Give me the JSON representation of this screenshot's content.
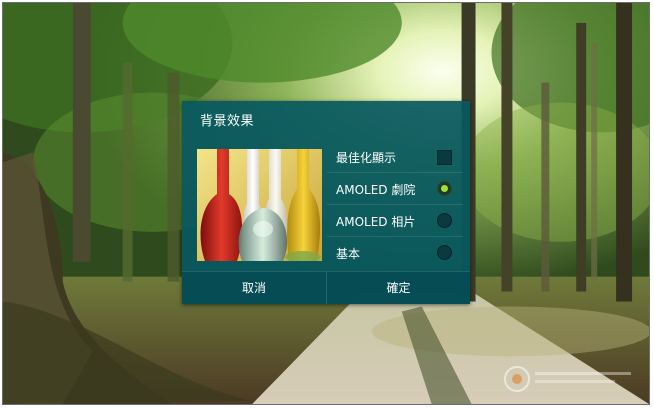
{
  "dialog": {
    "title": "背景效果",
    "options": [
      {
        "label": "最佳化顯示",
        "control": "checkbox",
        "checked": false
      },
      {
        "label": "AMOLED 劇院",
        "control": "radio",
        "checked": true
      },
      {
        "label": "AMOLED 相片",
        "control": "radio",
        "checked": false
      },
      {
        "label": "基本",
        "control": "radio",
        "checked": false
      }
    ],
    "cancel_label": "取消",
    "ok_label": "確定"
  },
  "colors": {
    "dialog_bg": "#085860",
    "radio_selected": "#9fe03a"
  },
  "icons": {
    "preview": "colored-bottles-image",
    "wallpaper": "forest-wallpaper"
  }
}
